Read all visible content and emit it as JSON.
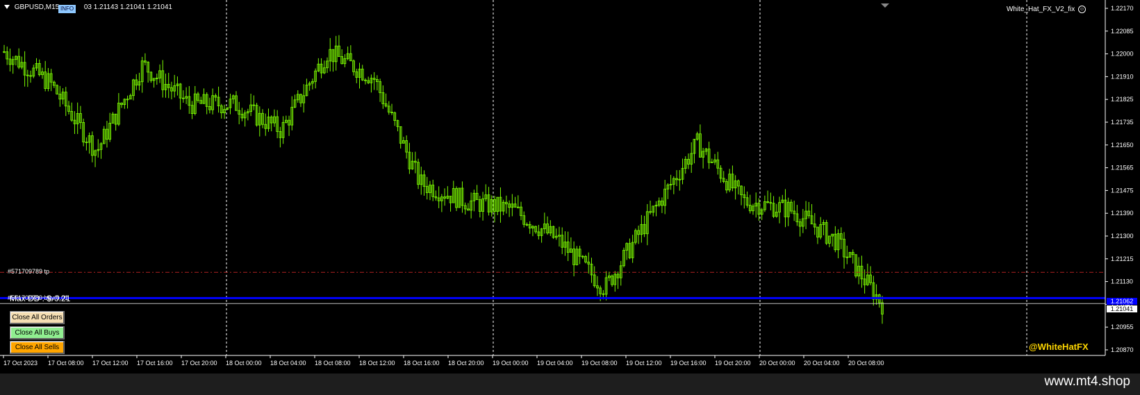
{
  "header": {
    "symbol_timeframe": "GBPUSD,M15",
    "info_badge": "INFO",
    "ohlc": "03 1.21143 1.21041 1.21041",
    "ea_name": "White_Hat_FX_V2_fix"
  },
  "panel": {
    "close_all_orders": "Close All Orders",
    "close_all_buys": "Close All Buys",
    "close_all_sells": "Close All Sells"
  },
  "lines": {
    "tp_label": "#571709789 tp",
    "order_label": "#571709789 buy 0.01",
    "max_dd_label": "Max DD : $-0.21",
    "tp_price": 1.2116,
    "order_price": 1.21062,
    "bid_price": 1.21041,
    "tp_color": "#b22222",
    "order_color": "#0000ff"
  },
  "price_axis": {
    "ticks": [
      "1.22170",
      "1.22085",
      "1.22000",
      "1.21910",
      "1.21825",
      "1.21735",
      "1.21650",
      "1.21565",
      "1.21475",
      "1.21390",
      "1.21300",
      "1.21215",
      "1.21130",
      "1.21041",
      "1.20955",
      "1.20870"
    ],
    "bid_box": "1.21041",
    "ask_box": "1.21062"
  },
  "time_axis": {
    "ticks": [
      "17 Oct 2023",
      "17 Oct 08:00",
      "17 Oct 12:00",
      "17 Oct 16:00",
      "17 Oct 20:00",
      "18 Oct 00:00",
      "18 Oct 04:00",
      "18 Oct 08:00",
      "18 Oct 12:00",
      "18 Oct 16:00",
      "18 Oct 20:00",
      "19 Oct 00:00",
      "19 Oct 04:00",
      "19 Oct 08:00",
      "19 Oct 12:00",
      "19 Oct 16:00",
      "19 Oct 20:00",
      "20 Oct 00:00",
      "20 Oct 04:00",
      "20 Oct 08:00"
    ],
    "day_separators": [
      "18 Oct 00:00",
      "19 Oct 00:00",
      "20 Oct 00:00",
      "21 Oct 00:00"
    ]
  },
  "brand": "@WhiteHatFX",
  "watermark": "www.mt4.shop",
  "colors": {
    "background": "#000000",
    "candle": "#7cfc00",
    "grid": "#ffffff",
    "axis_text": "#ffffff",
    "brand": "#ffd700"
  },
  "chart_data": {
    "type": "line",
    "symbol": "GBPUSD",
    "timeframe": "M15",
    "ylim": [
      1.2087,
      1.2217
    ],
    "x": [
      "17 Oct 2023",
      "17 Oct 08:00",
      "17 Oct 12:00",
      "17 Oct 16:00",
      "17 Oct 20:00",
      "18 Oct 00:00",
      "18 Oct 04:00",
      "18 Oct 08:00",
      "18 Oct 12:00",
      "18 Oct 16:00",
      "18 Oct 20:00",
      "19 Oct 00:00",
      "19 Oct 04:00",
      "19 Oct 08:00",
      "19 Oct 12:00",
      "19 Oct 16:00",
      "19 Oct 20:00",
      "20 Oct 00:00",
      "20 Oct 04:00",
      "20 Oct 08:00"
    ],
    "series": [
      {
        "values": [
          1.22,
          1.2188,
          1.2162,
          1.2195,
          1.218,
          1.218,
          1.217,
          1.22,
          1.219,
          1.215,
          1.2143,
          1.214,
          1.2128,
          1.211,
          1.2138,
          1.2165,
          1.2143,
          1.214,
          1.2128,
          1.2104
        ]
      }
    ]
  }
}
